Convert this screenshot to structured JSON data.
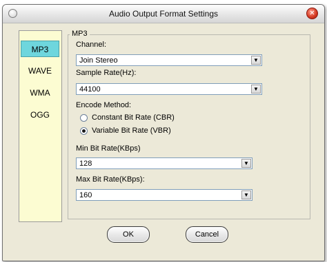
{
  "window": {
    "title": "Audio Output Format Settings"
  },
  "sidebar": {
    "items": [
      {
        "label": "MP3",
        "selected": true
      },
      {
        "label": "WAVE",
        "selected": false
      },
      {
        "label": "WMA",
        "selected": false
      },
      {
        "label": "OGG",
        "selected": false
      }
    ]
  },
  "group": {
    "legend": "MP3",
    "channel": {
      "label": "Channel:",
      "value": "Join Stereo"
    },
    "sample_rate": {
      "label": "Sample Rate(Hz):",
      "value": "44100"
    },
    "encode_method": {
      "label": "Encode Method:",
      "options": [
        {
          "label": "Constant Bit Rate (CBR)",
          "checked": false
        },
        {
          "label": "Variable Bit Rate (VBR)",
          "checked": true
        }
      ]
    },
    "min_bitrate": {
      "label": "Min Bit Rate(KBps)",
      "value": "128"
    },
    "max_bitrate": {
      "label": "Max Bit Rate(KBps):",
      "value": "160"
    }
  },
  "buttons": {
    "ok": "OK",
    "cancel": "Cancel"
  },
  "icons": {
    "dropdown": "chevron-down-icon",
    "close": "close-icon",
    "system": "system-menu-icon"
  },
  "colors": {
    "selected_tab": "#6ed6dd",
    "sidebar_bg": "#fcfcd2",
    "dialog_bg": "#ece9d8"
  }
}
